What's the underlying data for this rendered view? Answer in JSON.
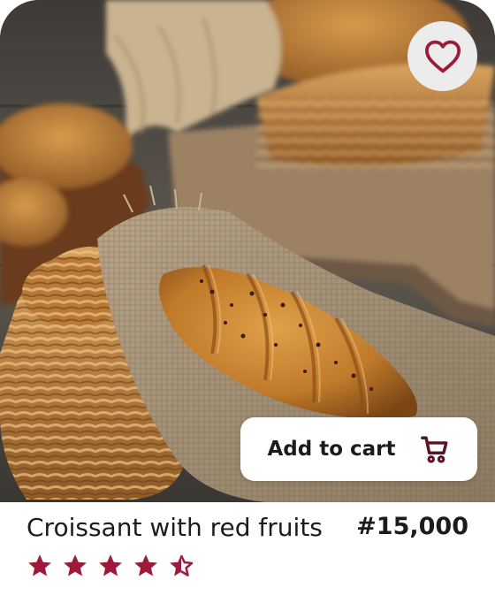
{
  "product": {
    "name": "Croissant with red fruits",
    "price": "#15,000",
    "rating": 4.5,
    "rating_max": 5
  },
  "actions": {
    "add_to_cart_label": "Add to cart",
    "cart_icon": "shopping-cart-icon",
    "favorite_icon": "heart-outline-icon"
  },
  "image": {
    "subject": "croissant on burlap beside wicker baskets"
  },
  "colors": {
    "accent": "#9c1b3a",
    "text": "#1c1c1c",
    "fav_bg": "#ececec",
    "card_bg": "#ffffff"
  }
}
